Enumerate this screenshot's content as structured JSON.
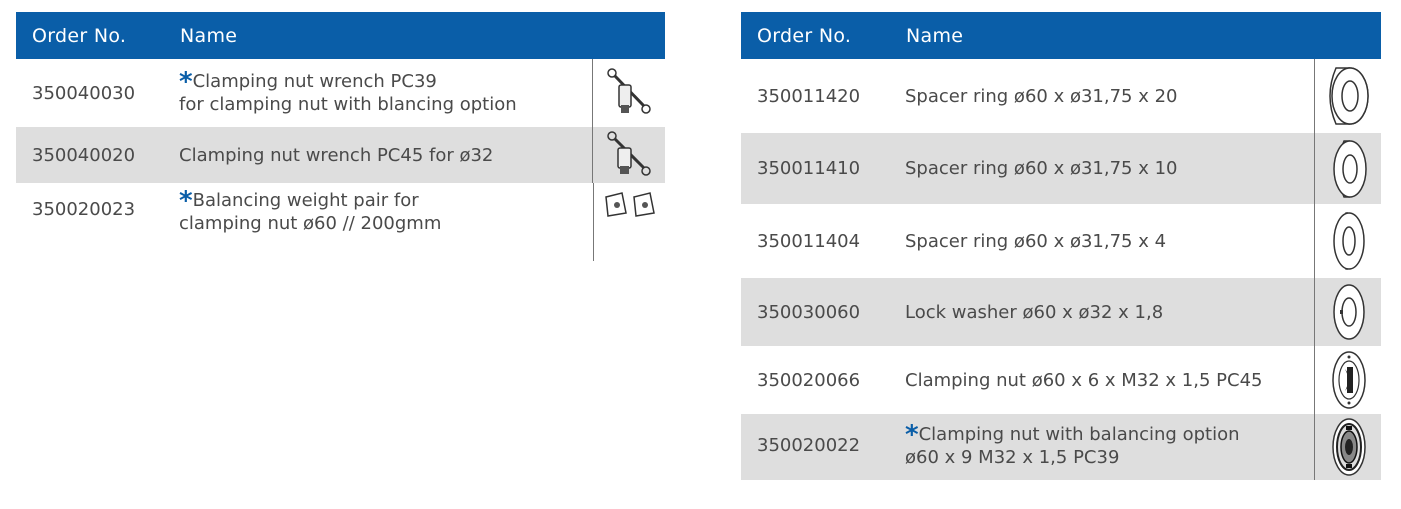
{
  "left_table": {
    "headers": {
      "order": "Order No.",
      "name": "Name"
    },
    "rows": [
      {
        "order": "350040030",
        "star": "*",
        "line1": "Clamping nut wrench PC39",
        "line2": "for clamping nut with blancing option",
        "icon": "wrench-icon"
      },
      {
        "order": "350040020",
        "star": "",
        "line1": "Clamping nut wrench PC45 for ø32",
        "line2": "",
        "icon": "wrench-icon"
      },
      {
        "order": "350020023",
        "star": "*",
        "line1": "Balancing weight pair for",
        "line2": "clamping nut ø60 // 200gmm",
        "icon": "balancing-weight-icon"
      }
    ]
  },
  "right_table": {
    "headers": {
      "order": "Order No.",
      "name": "Name"
    },
    "rows": [
      {
        "order": "350011420",
        "star": "",
        "line1": "Spacer ring ø60 x ø31,75 x 20",
        "line2": "",
        "icon": "spacer-ring-icon"
      },
      {
        "order": "350011410",
        "star": "",
        "line1": "Spacer ring ø60 x ø31,75 x 10",
        "line2": "",
        "icon": "spacer-ring-icon"
      },
      {
        "order": "350011404",
        "star": "",
        "line1": "Spacer ring ø60 x ø31,75 x 4",
        "line2": "",
        "icon": "spacer-ring-icon"
      },
      {
        "order": "350030060",
        "star": "",
        "line1": "Lock washer ø60 x ø32 x 1,8",
        "line2": "",
        "icon": "lock-washer-icon"
      },
      {
        "order": "350020066",
        "star": "",
        "line1": "Clamping nut ø60 x 6 x M32 x 1,5 PC45",
        "line2": "",
        "icon": "clamping-nut-icon"
      },
      {
        "order": "350020022",
        "star": "*",
        "line1": "Clamping nut with balancing option",
        "line2": "ø60 x 9 M32 x 1,5 PC39",
        "icon": "clamping-nut-balancing-icon"
      }
    ]
  },
  "colors": {
    "header_bg": "#0a5ea8",
    "header_text": "#ffffff",
    "row_shade": "#dedede",
    "text": "#4a4a4a"
  }
}
